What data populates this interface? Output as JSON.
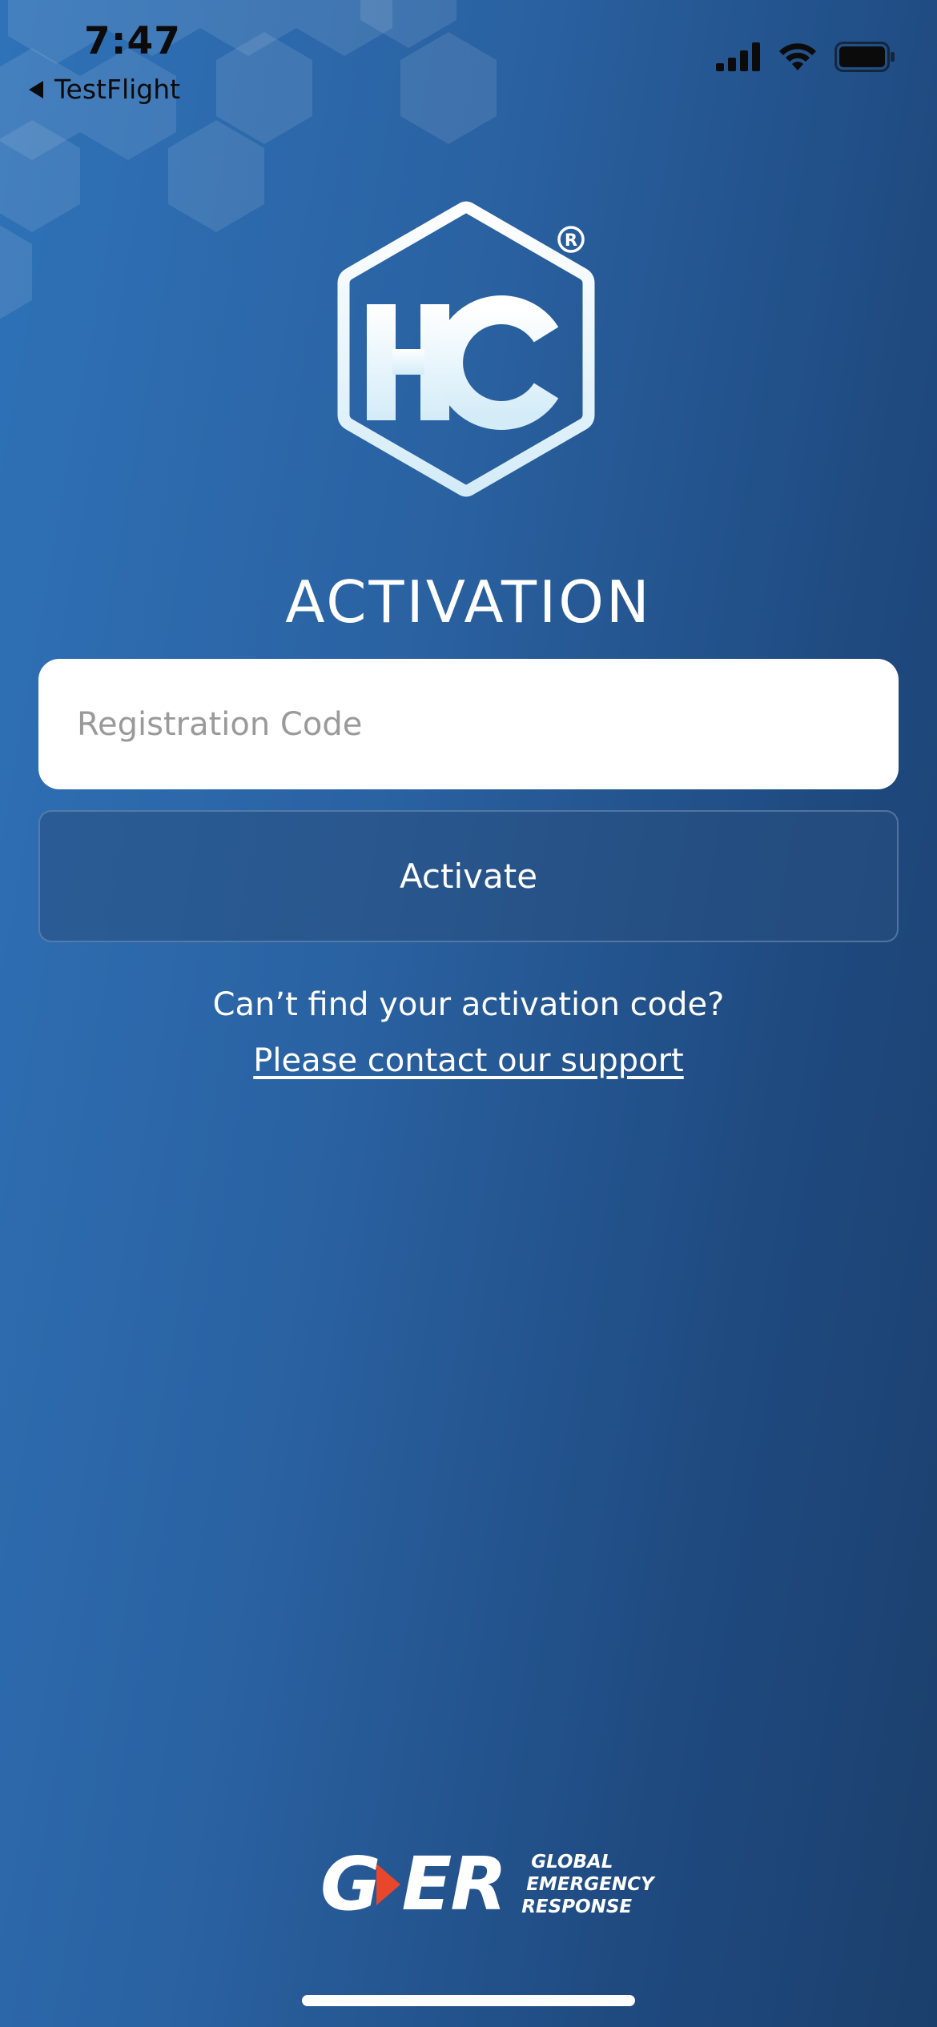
{
  "status_bar": {
    "time": "7:47",
    "back_label": "TestFlight",
    "icons": [
      "cellular-signal-icon",
      "wifi-icon",
      "battery-icon"
    ]
  },
  "logo": {
    "text": "HC",
    "registered_mark": "®"
  },
  "title": "ACTIVATION",
  "registration": {
    "placeholder": "Registration Code",
    "value": ""
  },
  "activate_button": {
    "label": "Activate"
  },
  "help": {
    "question": "Can’t find your activation code?",
    "link": "Please contact our support"
  },
  "footer": {
    "brand_mark": "GER",
    "brand_lines": [
      "GLOBAL",
      "EMERGENCY",
      "RESPONSE"
    ]
  },
  "colors": {
    "background_start": "#2f72b8",
    "background_end": "#1b3f6c",
    "accent_red": "#e8472c"
  }
}
